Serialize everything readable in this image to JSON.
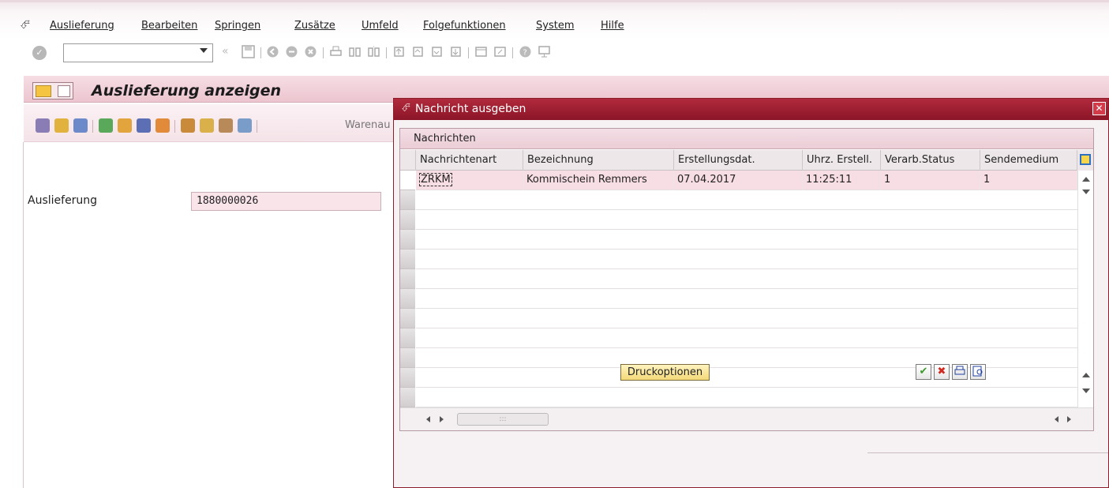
{
  "menu": {
    "items": [
      "Auslieferung",
      "Bearbeiten",
      "Springen",
      "Zusätze",
      "Umfeld",
      "Folgefunktionen",
      "System",
      "Hilfe"
    ]
  },
  "toolbar": {
    "command_value": "",
    "icons": [
      "save-icon",
      "back-icon",
      "exit-icon",
      "cancel-icon",
      "print-icon",
      "find-icon",
      "find-next-icon",
      "first-page-icon",
      "prev-page-icon",
      "next-page-icon",
      "last-page-icon",
      "new-session-icon",
      "shortcut-icon",
      "help-icon",
      "layout-icon"
    ]
  },
  "screen": {
    "title": "Auslieferung anzeigen",
    "app_toolbar_truncated_label": "Warenau",
    "field_label": "Auslieferung",
    "field_value": "1880000026"
  },
  "dialog": {
    "title": "Nachricht ausgeben",
    "close_symbol": "✕",
    "grid_caption": "Nachrichten",
    "columns": [
      "Nachrichtenart",
      "Bezeichnung",
      "Erstellungsdat.",
      "Uhrz. Erstell.",
      "Verarb.Status",
      "Sendemedium"
    ],
    "rows": [
      [
        "ZRKM",
        "Kommischein Remmers",
        "07.04.2017",
        "11:25:11",
        "1",
        "1"
      ]
    ],
    "buttons": {
      "confirm_symbol": "✔",
      "cancel_symbol": "✖",
      "druck_label": "Druckoptionen"
    }
  },
  "colors": {
    "dialog_header": "#8b1527",
    "selected_row": "#f7dde4",
    "title_bar": "#ecc5cf",
    "field_bg": "#f9e4ea"
  }
}
